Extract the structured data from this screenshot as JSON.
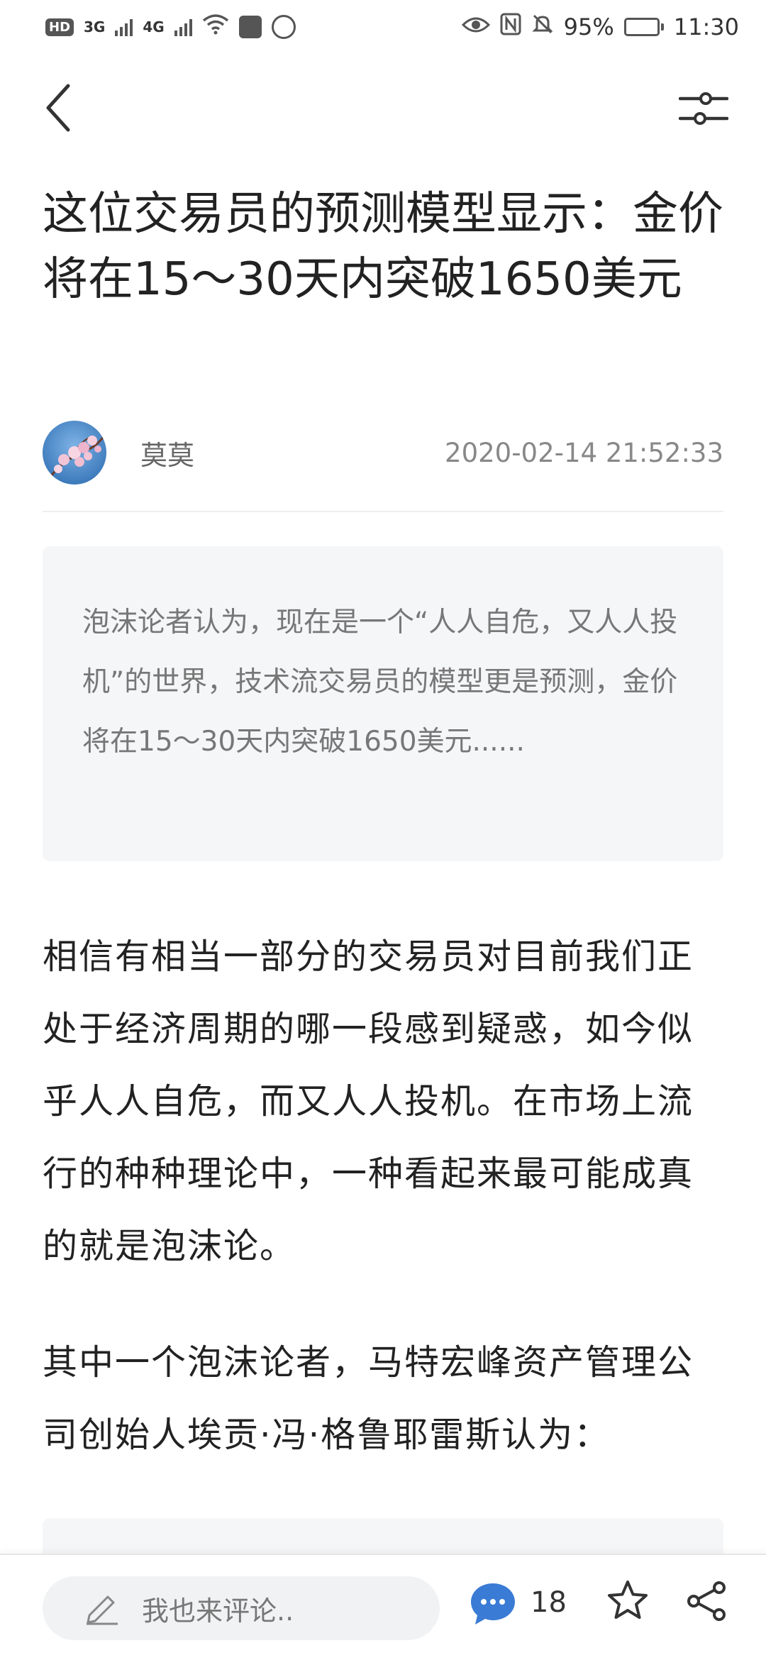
{
  "status_bar": {
    "hd_label": "HD",
    "net_3g": "3G",
    "net_4g": "4G",
    "battery_percent": "95%",
    "battery_level": 0.95,
    "time": "11:30"
  },
  "article": {
    "title": "这位交易员的预测模型显示：金价将在15～30天内突破1650美元",
    "author": "莫莫",
    "publish_time": "2020-02-14 21:52:33",
    "summary": "泡沫论者认为，现在是一个“人人自危，又人人投机”的世界，技术流交易员的模型更是预测，金价将在15～30天内突破1650美元......",
    "paragraphs": [
      "相信有相当一部分的交易员对目前我们正处于经济周期的哪一段感到疑惑，如今似乎人人自危，而又人人投机。在市场上流行的种种理论中，一种看起来最可能成真的就是泡沫论。",
      "其中一个泡沫论者，马特宏峰资产管理公司创始人埃贡·冯·格鲁耶雷斯认为："
    ]
  },
  "bottom_bar": {
    "comment_placeholder": "我也来评论..",
    "comment_count": "18"
  },
  "icons": {
    "back": "back-arrow-icon",
    "settings": "sliders-icon",
    "comment": "chat-bubble-icon",
    "favorite": "star-icon",
    "share": "share-icon",
    "edit": "pencil-icon"
  },
  "colors": {
    "accent_blue": "#3a7bd5",
    "summary_bg": "#f5f6f8",
    "text_main": "#222222",
    "text_muted": "#777777"
  }
}
